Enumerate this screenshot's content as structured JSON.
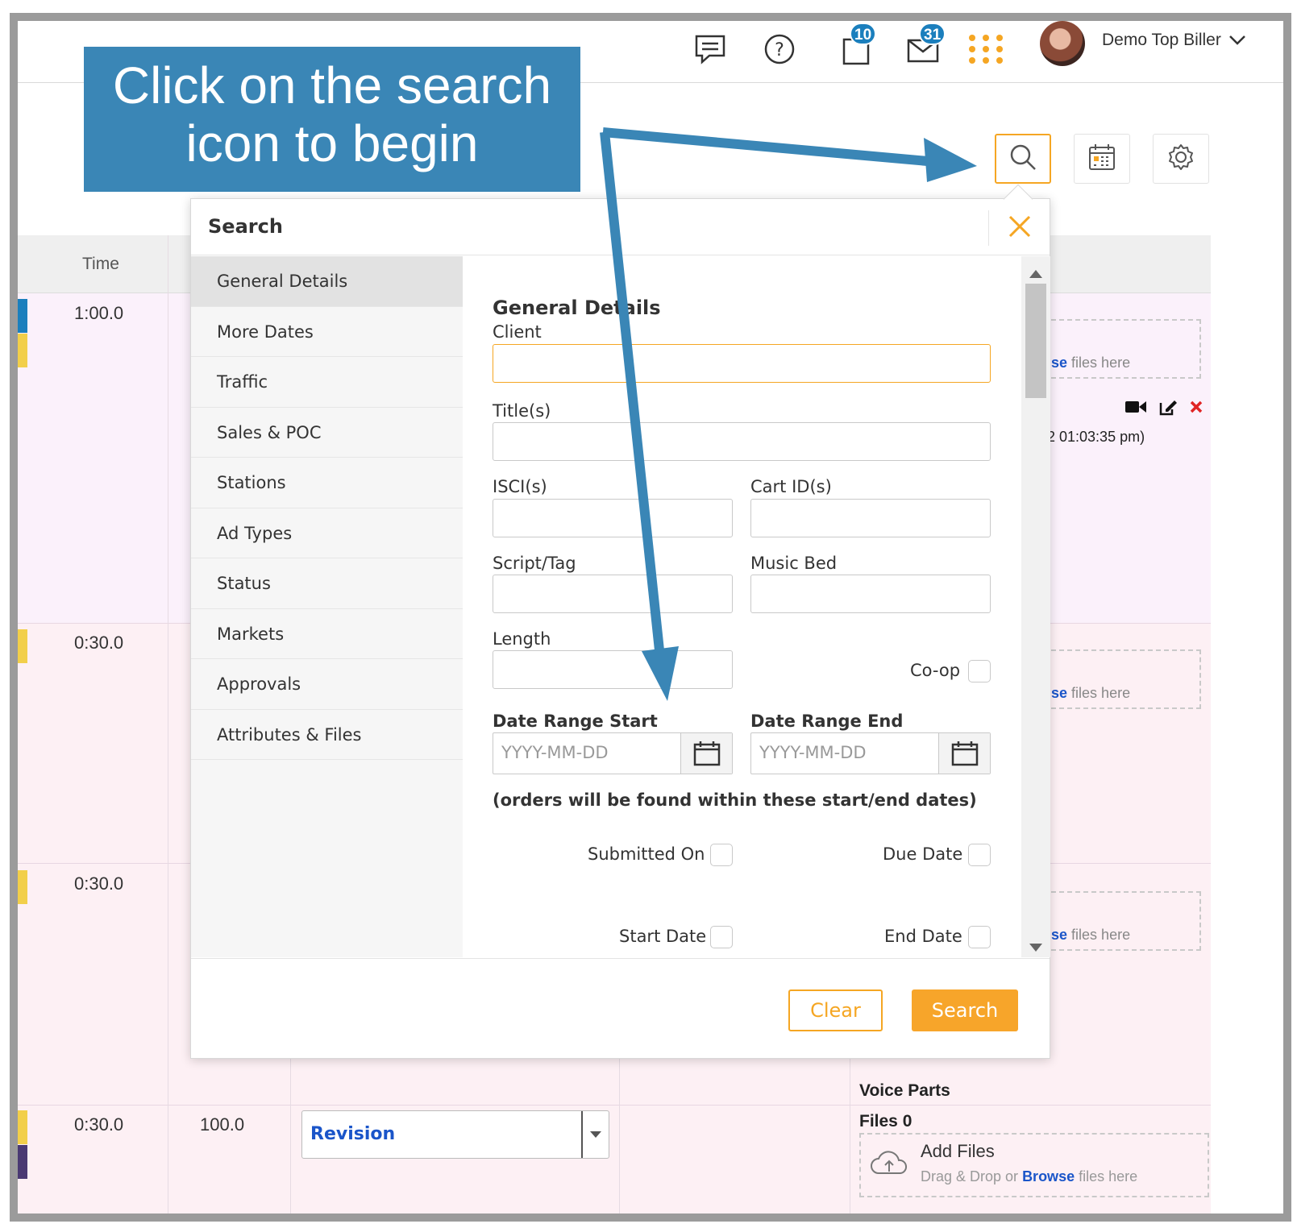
{
  "header": {
    "chat_icon": "chat-icon",
    "help_icon": "help-icon",
    "clipboard_badge": "10",
    "mail_badge": "31",
    "user_name": "Demo Top Biller"
  },
  "callout": {
    "line1": "Click on the search",
    "line2": "icon to begin"
  },
  "grid": {
    "time_header": "Time",
    "rows": [
      {
        "time": "1:00.0"
      },
      {
        "time": "0:30.0"
      },
      {
        "time": "0:30.0"
      },
      {
        "time": "0:30.0",
        "percent": "100.0",
        "status": "Revision"
      }
    ],
    "drop_text_browse": "se",
    "drop_text_files": "files here",
    "timestamp": "2 01:03:35 pm)",
    "voice_parts": "Voice Parts",
    "files_count": "Files 0",
    "add_files": "Add Files",
    "drag_drop": "Drag & Drop or",
    "browse": "Browse",
    "files_here": "files here"
  },
  "modal": {
    "title": "Search",
    "nav": [
      "General Details",
      "More Dates",
      "Traffic",
      "Sales & POC",
      "Stations",
      "Ad Types",
      "Status",
      "Markets",
      "Approvals",
      "Attributes & Files"
    ],
    "section_title": "General Details",
    "client_label": "Client",
    "titles_label": "Title(s)",
    "isci_label": "ISCI(s)",
    "cart_label": "Cart ID(s)",
    "script_label": "Script/Tag",
    "music_label": "Music Bed",
    "length_label": "Length",
    "coop_label": "Co-op",
    "date_start_label": "Date Range Start",
    "date_end_label": "Date Range End",
    "date_placeholder": "YYYY-MM-DD",
    "date_note": "(orders will be found within these start/end dates)",
    "submitted_on": "Submitted On",
    "due_date": "Due Date",
    "start_date": "Start Date",
    "end_date": "End Date",
    "clear_label": "Clear",
    "search_label": "Search"
  },
  "colors": {
    "accent": "#f5a623",
    "callout_bg": "#3a86b6",
    "badge": "#1b7fbd"
  }
}
